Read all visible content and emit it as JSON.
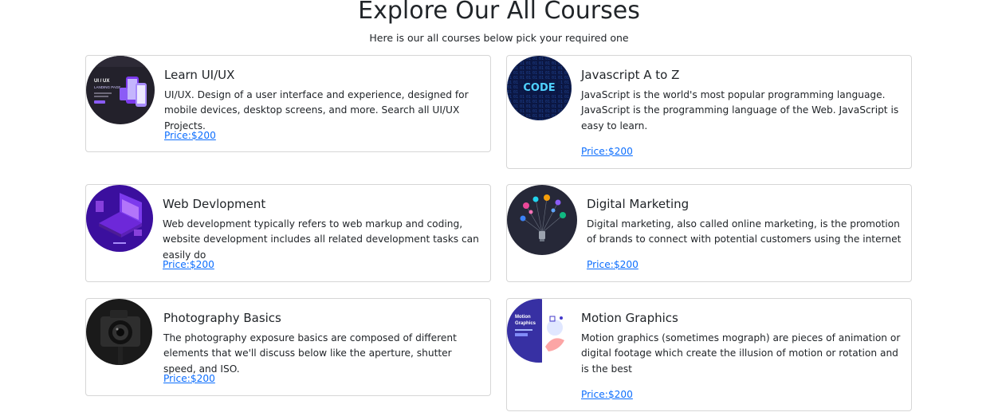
{
  "header": {
    "title": "Explore Our All Courses",
    "subtitle": "Here is our all courses below pick your required one"
  },
  "courses": [
    {
      "title": "Learn UI/UX",
      "description": "UI/UX. Design of a user interface and experience, designed for mobile devices, desktop screens, and more. Search all UI/UX Projects.",
      "price": "Price:$200",
      "image_icon": "ui-ux-landing-page-thumbnail",
      "image_text": [
        "UI / UX",
        "LANDING PAGE"
      ]
    },
    {
      "title": "Javascript A to Z",
      "description": "JavaScript is the world's most popular programming language. JavaScript is the programming language of the Web. JavaScript is easy to learn.",
      "price": "Price:$200",
      "image_icon": "code-thumbnail",
      "image_text": [
        "CODE"
      ]
    },
    {
      "title": "Web Devlopment",
      "description": "Web development typically refers to web markup and coding, website development includes all related development tasks can easily do",
      "price": "Price:$200",
      "image_icon": "isometric-laptop-thumbnail"
    },
    {
      "title": "Digital Marketing",
      "description": "Digital marketing, also called online marketing, is the promotion of brands to connect with potential customers using the internet",
      "price": "Price:$200",
      "image_icon": "social-media-bulb-thumbnail"
    },
    {
      "title": "Photography Basics",
      "description": "The photography exposure basics are composed of different elements that we'll discuss below like the aperture, shutter speed, and ISO.",
      "price": "Price:$200",
      "image_icon": "camera-thumbnail"
    },
    {
      "title": "Motion Graphics",
      "description": "Motion graphics (sometimes mograph) are pieces of animation or digital footage which create the illusion of motion or rotation and is the best",
      "price": "Price:$200",
      "image_icon": "motion-graphics-thumbnail",
      "image_text": [
        "Motion",
        "Graphics"
      ]
    }
  ],
  "colors": {
    "link": "#0d6efd",
    "card_border": "#d6d6d6",
    "text": "#212529"
  }
}
